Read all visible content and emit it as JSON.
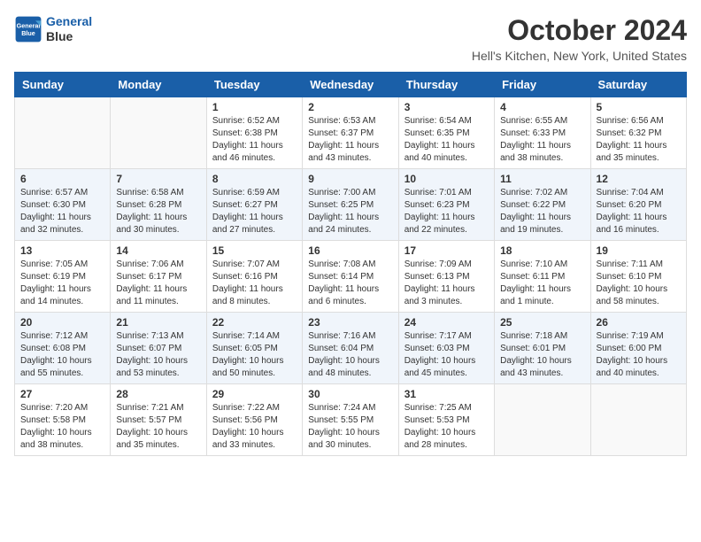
{
  "logo": {
    "line1": "General",
    "line2": "Blue"
  },
  "title": "October 2024",
  "subtitle": "Hell's Kitchen, New York, United States",
  "days_header": [
    "Sunday",
    "Monday",
    "Tuesday",
    "Wednesday",
    "Thursday",
    "Friday",
    "Saturday"
  ],
  "weeks": [
    [
      {
        "day": "",
        "info": ""
      },
      {
        "day": "",
        "info": ""
      },
      {
        "day": "1",
        "info": "Sunrise: 6:52 AM\nSunset: 6:38 PM\nDaylight: 11 hours and 46 minutes."
      },
      {
        "day": "2",
        "info": "Sunrise: 6:53 AM\nSunset: 6:37 PM\nDaylight: 11 hours and 43 minutes."
      },
      {
        "day": "3",
        "info": "Sunrise: 6:54 AM\nSunset: 6:35 PM\nDaylight: 11 hours and 40 minutes."
      },
      {
        "day": "4",
        "info": "Sunrise: 6:55 AM\nSunset: 6:33 PM\nDaylight: 11 hours and 38 minutes."
      },
      {
        "day": "5",
        "info": "Sunrise: 6:56 AM\nSunset: 6:32 PM\nDaylight: 11 hours and 35 minutes."
      }
    ],
    [
      {
        "day": "6",
        "info": "Sunrise: 6:57 AM\nSunset: 6:30 PM\nDaylight: 11 hours and 32 minutes."
      },
      {
        "day": "7",
        "info": "Sunrise: 6:58 AM\nSunset: 6:28 PM\nDaylight: 11 hours and 30 minutes."
      },
      {
        "day": "8",
        "info": "Sunrise: 6:59 AM\nSunset: 6:27 PM\nDaylight: 11 hours and 27 minutes."
      },
      {
        "day": "9",
        "info": "Sunrise: 7:00 AM\nSunset: 6:25 PM\nDaylight: 11 hours and 24 minutes."
      },
      {
        "day": "10",
        "info": "Sunrise: 7:01 AM\nSunset: 6:23 PM\nDaylight: 11 hours and 22 minutes."
      },
      {
        "day": "11",
        "info": "Sunrise: 7:02 AM\nSunset: 6:22 PM\nDaylight: 11 hours and 19 minutes."
      },
      {
        "day": "12",
        "info": "Sunrise: 7:04 AM\nSunset: 6:20 PM\nDaylight: 11 hours and 16 minutes."
      }
    ],
    [
      {
        "day": "13",
        "info": "Sunrise: 7:05 AM\nSunset: 6:19 PM\nDaylight: 11 hours and 14 minutes."
      },
      {
        "day": "14",
        "info": "Sunrise: 7:06 AM\nSunset: 6:17 PM\nDaylight: 11 hours and 11 minutes."
      },
      {
        "day": "15",
        "info": "Sunrise: 7:07 AM\nSunset: 6:16 PM\nDaylight: 11 hours and 8 minutes."
      },
      {
        "day": "16",
        "info": "Sunrise: 7:08 AM\nSunset: 6:14 PM\nDaylight: 11 hours and 6 minutes."
      },
      {
        "day": "17",
        "info": "Sunrise: 7:09 AM\nSunset: 6:13 PM\nDaylight: 11 hours and 3 minutes."
      },
      {
        "day": "18",
        "info": "Sunrise: 7:10 AM\nSunset: 6:11 PM\nDaylight: 11 hours and 1 minute."
      },
      {
        "day": "19",
        "info": "Sunrise: 7:11 AM\nSunset: 6:10 PM\nDaylight: 10 hours and 58 minutes."
      }
    ],
    [
      {
        "day": "20",
        "info": "Sunrise: 7:12 AM\nSunset: 6:08 PM\nDaylight: 10 hours and 55 minutes."
      },
      {
        "day": "21",
        "info": "Sunrise: 7:13 AM\nSunset: 6:07 PM\nDaylight: 10 hours and 53 minutes."
      },
      {
        "day": "22",
        "info": "Sunrise: 7:14 AM\nSunset: 6:05 PM\nDaylight: 10 hours and 50 minutes."
      },
      {
        "day": "23",
        "info": "Sunrise: 7:16 AM\nSunset: 6:04 PM\nDaylight: 10 hours and 48 minutes."
      },
      {
        "day": "24",
        "info": "Sunrise: 7:17 AM\nSunset: 6:03 PM\nDaylight: 10 hours and 45 minutes."
      },
      {
        "day": "25",
        "info": "Sunrise: 7:18 AM\nSunset: 6:01 PM\nDaylight: 10 hours and 43 minutes."
      },
      {
        "day": "26",
        "info": "Sunrise: 7:19 AM\nSunset: 6:00 PM\nDaylight: 10 hours and 40 minutes."
      }
    ],
    [
      {
        "day": "27",
        "info": "Sunrise: 7:20 AM\nSunset: 5:58 PM\nDaylight: 10 hours and 38 minutes."
      },
      {
        "day": "28",
        "info": "Sunrise: 7:21 AM\nSunset: 5:57 PM\nDaylight: 10 hours and 35 minutes."
      },
      {
        "day": "29",
        "info": "Sunrise: 7:22 AM\nSunset: 5:56 PM\nDaylight: 10 hours and 33 minutes."
      },
      {
        "day": "30",
        "info": "Sunrise: 7:24 AM\nSunset: 5:55 PM\nDaylight: 10 hours and 30 minutes."
      },
      {
        "day": "31",
        "info": "Sunrise: 7:25 AM\nSunset: 5:53 PM\nDaylight: 10 hours and 28 minutes."
      },
      {
        "day": "",
        "info": ""
      },
      {
        "day": "",
        "info": ""
      }
    ]
  ]
}
